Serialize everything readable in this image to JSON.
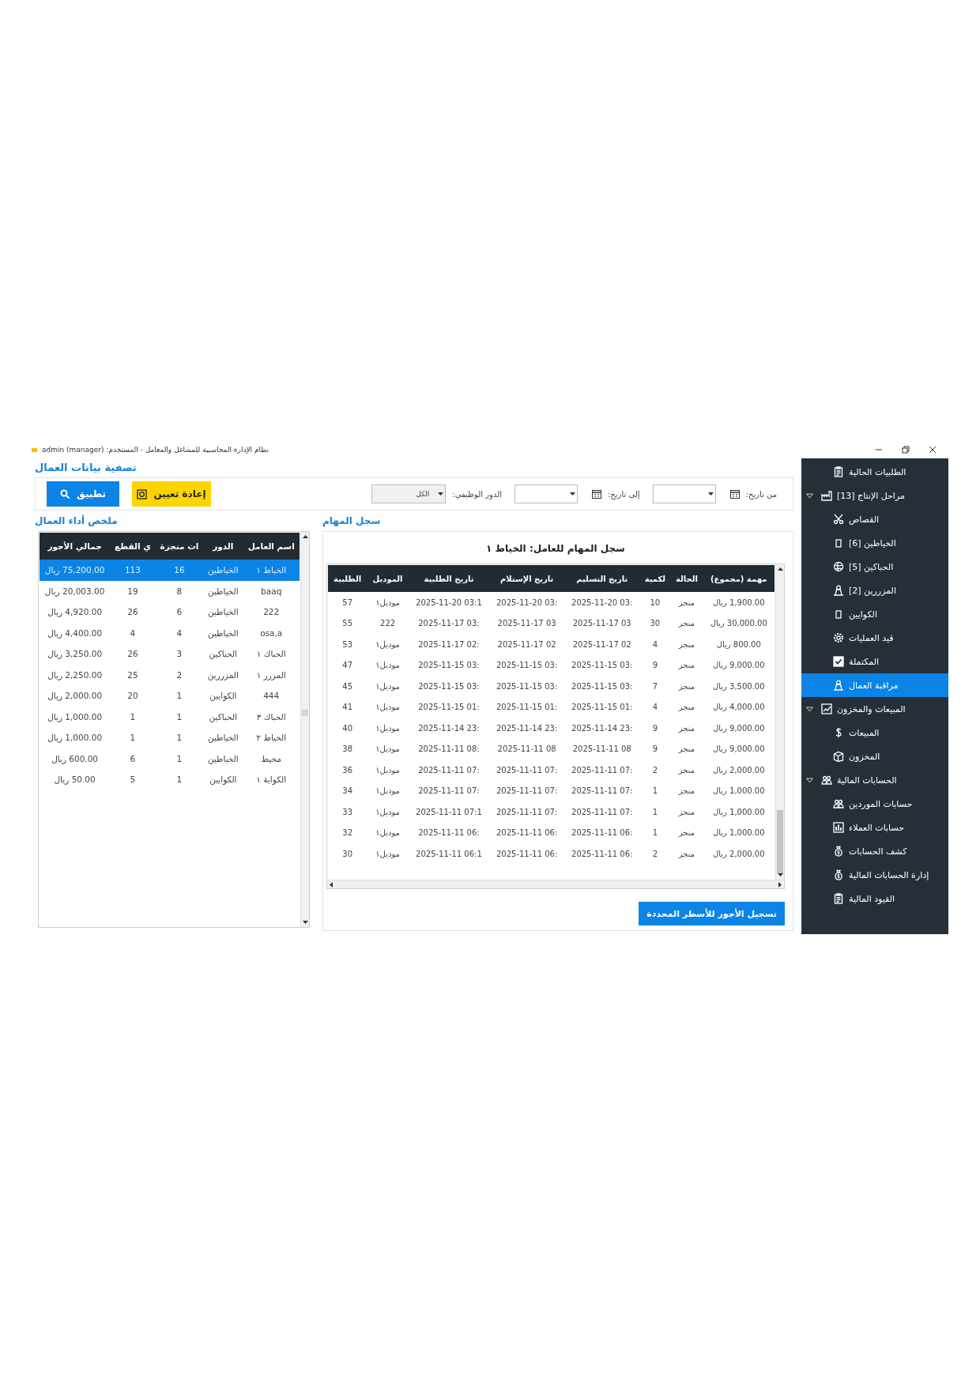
{
  "window": {
    "title": "نظام الإدارة المحاسبية للمشاغل والمعامل - المستخدم: admin (manager)"
  },
  "filter": {
    "title": "تصفية بيانات العمال",
    "from_label": "من تاريخ:",
    "to_label": "إلى تاريخ:",
    "role_label": "الدور الوظيفي:",
    "role_value": "الكل",
    "reset_button": "إعادة تعيين",
    "apply_button": "تطبيق"
  },
  "summary": {
    "title": "ملخص أداء العمال",
    "columns": [
      "اسم العامل",
      "الدور",
      "ات منجزة",
      "ي القطع",
      "جمالي الأجور"
    ],
    "rows": [
      {
        "cells": [
          "الخياط ١",
          "الخياطين",
          "16",
          "113",
          "75,200.00 ريال"
        ],
        "selected": true
      },
      {
        "cells": [
          "baaq",
          "الخياطين",
          "8",
          "19",
          "20,003.00 ريال"
        ],
        "selected": false
      },
      {
        "cells": [
          "222",
          "الخياطين",
          "6",
          "26",
          "4,920.00 ريال"
        ],
        "selected": false
      },
      {
        "cells": [
          "osa,a",
          "الخياطين",
          "4",
          "4",
          "4,400.00 ريال"
        ],
        "selected": false
      },
      {
        "cells": [
          "الحباك ١",
          "الحباكين",
          "3",
          "26",
          "3,250.00 ريال"
        ],
        "selected": false
      },
      {
        "cells": [
          "المزرر ١",
          "المزررين",
          "2",
          "25",
          "2,250.00 ريال"
        ],
        "selected": false
      },
      {
        "cells": [
          "444",
          "الكوايين",
          "1",
          "20",
          "2,000.00 ريال"
        ],
        "selected": false
      },
      {
        "cells": [
          "الحباك ٣",
          "الحباكين",
          "1",
          "1",
          "1,000.00 ريال"
        ],
        "selected": false
      },
      {
        "cells": [
          "الخياط ٢",
          "الخياطين",
          "1",
          "1",
          "1,000.00 ريال"
        ],
        "selected": false
      },
      {
        "cells": [
          "مخيط",
          "الخياطين",
          "1",
          "6",
          "600.00 ريال"
        ],
        "selected": false
      },
      {
        "cells": [
          "الكواية ١",
          "الكوايين",
          "1",
          "5",
          "50.00 ريال"
        ],
        "selected": false
      }
    ]
  },
  "tasks": {
    "title": "سجل المهام",
    "heading": "سجل المهام للعامل: الخياط ١",
    "columns": [
      "مهمة (مجموع)",
      "الحالة",
      "لكمية",
      "تاريخ التسليم",
      "تاريخ الإستلام",
      "تاريخ الطلبية",
      "الموديل",
      "الطلبية"
    ],
    "rows": [
      {
        "cells": [
          "1,900.00 ريال",
          "منجز",
          "10",
          "2025-11-20 03:",
          "2025-11-20 03:",
          "2025-11-20 03:1",
          "موديل١",
          "57"
        ]
      },
      {
        "cells": [
          "30,000.00 ريال",
          "منجز",
          "30",
          "2025-11-17 03",
          "2025-11-17 03",
          "2025-11-17 03:",
          "222",
          "55"
        ]
      },
      {
        "cells": [
          "800.00 ريال",
          "منجز",
          "4",
          "2025-11-17 02",
          "2025-11-17 02",
          "2025-11-17 02:",
          "موديل١",
          "53"
        ]
      },
      {
        "cells": [
          "9,000.00 ريال",
          "منجز",
          "9",
          "2025-11-15 03:",
          "2025-11-15 03:",
          "2025-11-15 03:",
          "موديل١",
          "47"
        ]
      },
      {
        "cells": [
          "3,500.00 ريال",
          "منجز",
          "7",
          "2025-11-15 03:",
          "2025-11-15 03:",
          "2025-11-15 03:",
          "موديل١",
          "45"
        ]
      },
      {
        "cells": [
          "4,000.00 ريال",
          "منجز",
          "4",
          "2025-11-15 01:",
          "2025-11-15 01:",
          "2025-11-15 01:",
          "موديل١",
          "41"
        ]
      },
      {
        "cells": [
          "9,000.00 ريال",
          "منجز",
          "9",
          "2025-11-14 23:",
          "2025-11-14 23:",
          "2025-11-14 23:",
          "موديل١",
          "40"
        ]
      },
      {
        "cells": [
          "9,000.00 ريال",
          "منجز",
          "9",
          "2025-11-11 08",
          "2025-11-11 08",
          "2025-11-11 08:",
          "موديل١",
          "38"
        ]
      },
      {
        "cells": [
          "2,000.00 ريال",
          "منجز",
          "2",
          "2025-11-11 07:",
          "2025-11-11 07:",
          "2025-11-11 07:",
          "موديل١",
          "36"
        ]
      },
      {
        "cells": [
          "1,000.00 ريال",
          "منجز",
          "1",
          "2025-11-11 07:",
          "2025-11-11 07:",
          "2025-11-11 07:",
          "موديل١",
          "34"
        ]
      },
      {
        "cells": [
          "1,000.00 ريال",
          "منجز",
          "1",
          "2025-11-11 07:",
          "2025-11-11 07:",
          "2025-11-11 07:1",
          "موديل١",
          "33"
        ]
      },
      {
        "cells": [
          "1,000.00 ريال",
          "منجز",
          "1",
          "2025-11-11 06:",
          "2025-11-11 06:",
          "2025-11-11 06:",
          "موديل١",
          "32"
        ]
      },
      {
        "cells": [
          "2,000.00 ريال",
          "منجز",
          "2",
          "2025-11-11 06:",
          "2025-11-11 06:",
          "2025-11-11 06:1",
          "موديل١",
          "30"
        ]
      }
    ],
    "save_button": "تسجيل الأجور للأسطر المحددة"
  },
  "sidebar": {
    "items": [
      {
        "label": "الطلبيات الحالية",
        "selected": false
      },
      {
        "label": "مراحل الإنتاج [13]",
        "selected": false,
        "expanded": true,
        "children": [
          {
            "label": "القصاص",
            "selected": false
          },
          {
            "label": "الخياطين [6]",
            "selected": false
          },
          {
            "label": "الحباكين [5]",
            "selected": false
          },
          {
            "label": "المزررين [2]",
            "selected": false
          },
          {
            "label": "الكوايين",
            "selected": false
          },
          {
            "label": "قيد العمليات",
            "selected": false
          },
          {
            "label": "المكتملة",
            "selected": false
          },
          {
            "label": "مراقبة العمال",
            "selected": true
          }
        ]
      },
      {
        "label": "المبيعات والمخزون",
        "selected": false,
        "expanded": true,
        "children": [
          {
            "label": "المبيعات",
            "selected": false
          },
          {
            "label": "المخزون",
            "selected": false
          }
        ]
      },
      {
        "label": "الحسابات المالية",
        "selected": false,
        "expanded": true,
        "children": [
          {
            "label": "حسابات الموردين",
            "selected": false
          },
          {
            "label": "حسابات العملاء",
            "selected": false
          },
          {
            "label": "كشف الحسابات",
            "selected": false
          },
          {
            "label": "إدارة الحسابات المالية",
            "selected": false
          },
          {
            "label": "القيود المالية",
            "selected": false
          }
        ]
      }
    ]
  }
}
